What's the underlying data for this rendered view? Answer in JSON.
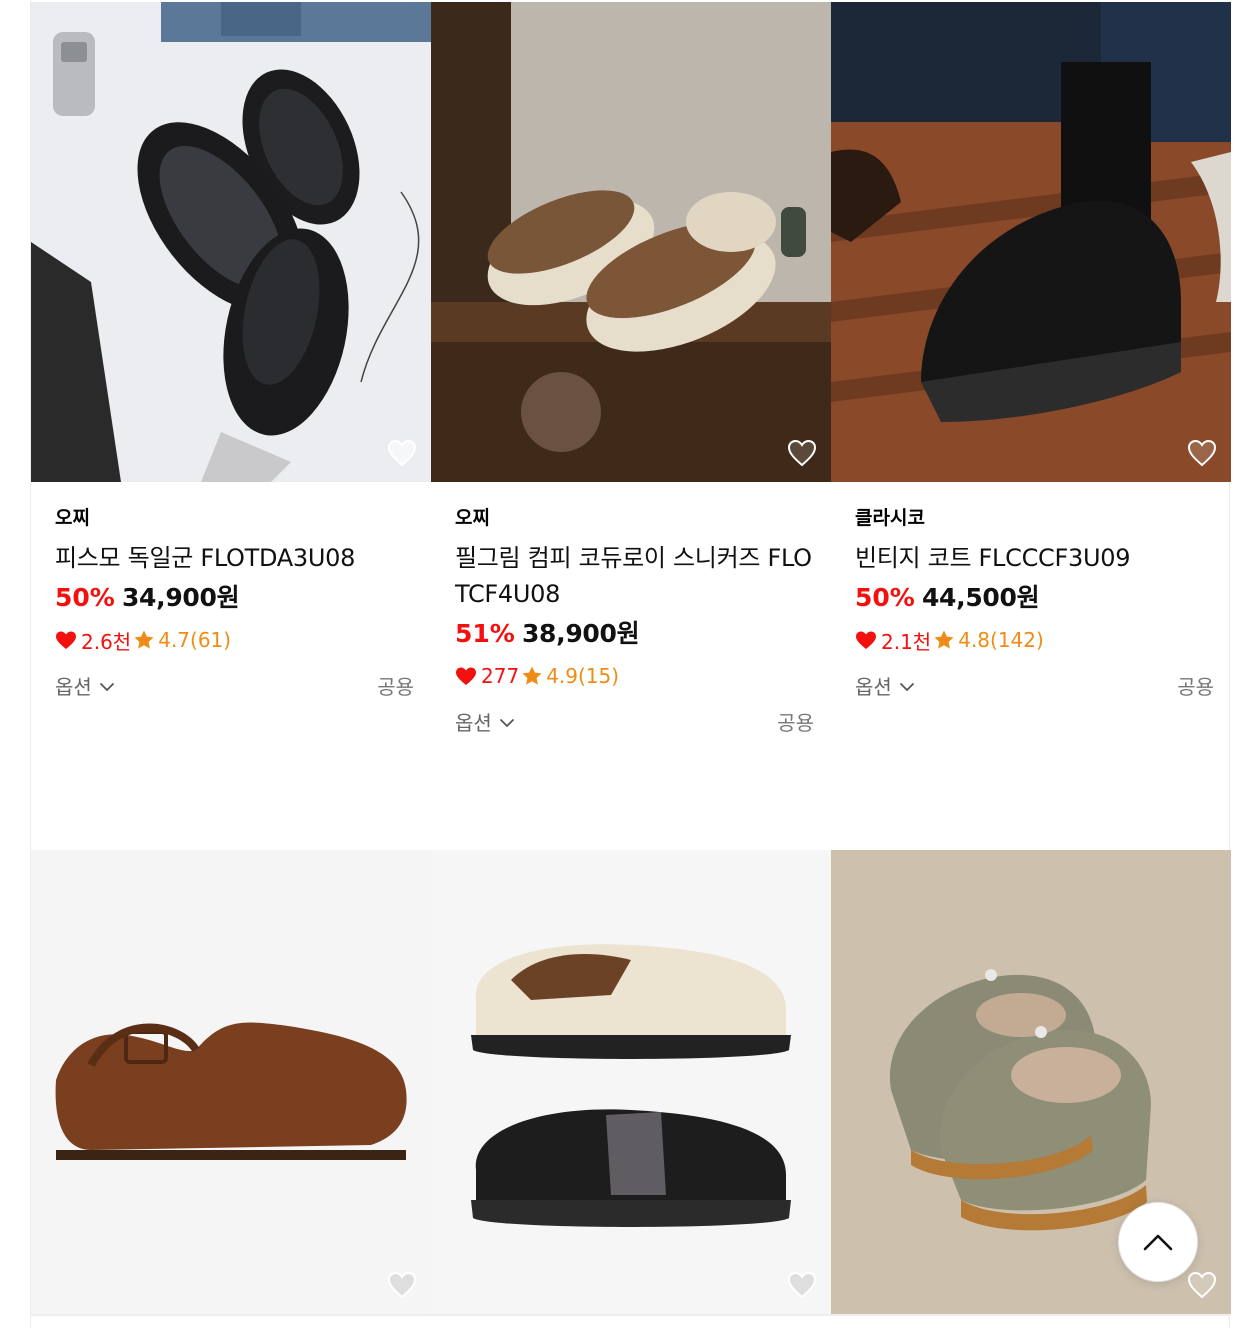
{
  "colors": {
    "discount": "#f31110",
    "rating": "#f08c16",
    "heart_red": "#f31110"
  },
  "products": [
    {
      "brand": "오찌",
      "title": "피스모 독일군 FLOTDA3U08",
      "discount": "50%",
      "price": "34,900원",
      "likes": "2.6천",
      "rating": "4.7(61)",
      "option_label": "옵션",
      "gender": "공용"
    },
    {
      "brand": "오찌",
      "title": "필그림 컴피 코듀로이 스니커즈 FLOTCF4U08",
      "discount": "51%",
      "price": "38,900원",
      "likes": "277",
      "rating": "4.9(15)",
      "option_label": "옵션",
      "gender": "공용"
    },
    {
      "brand": "클라시코",
      "title": "빈티지 코트 FLCCCF3U09",
      "discount": "50%",
      "price": "44,500원",
      "likes": "2.1천",
      "rating": "4.8(142)",
      "option_label": "옵션",
      "gender": "공용"
    }
  ],
  "icons": {
    "wishlist": "heart-outline-icon",
    "likes": "heart-icon",
    "rating": "star-icon",
    "options": "chevron-down-icon",
    "scroll_top": "chevron-up-icon"
  }
}
